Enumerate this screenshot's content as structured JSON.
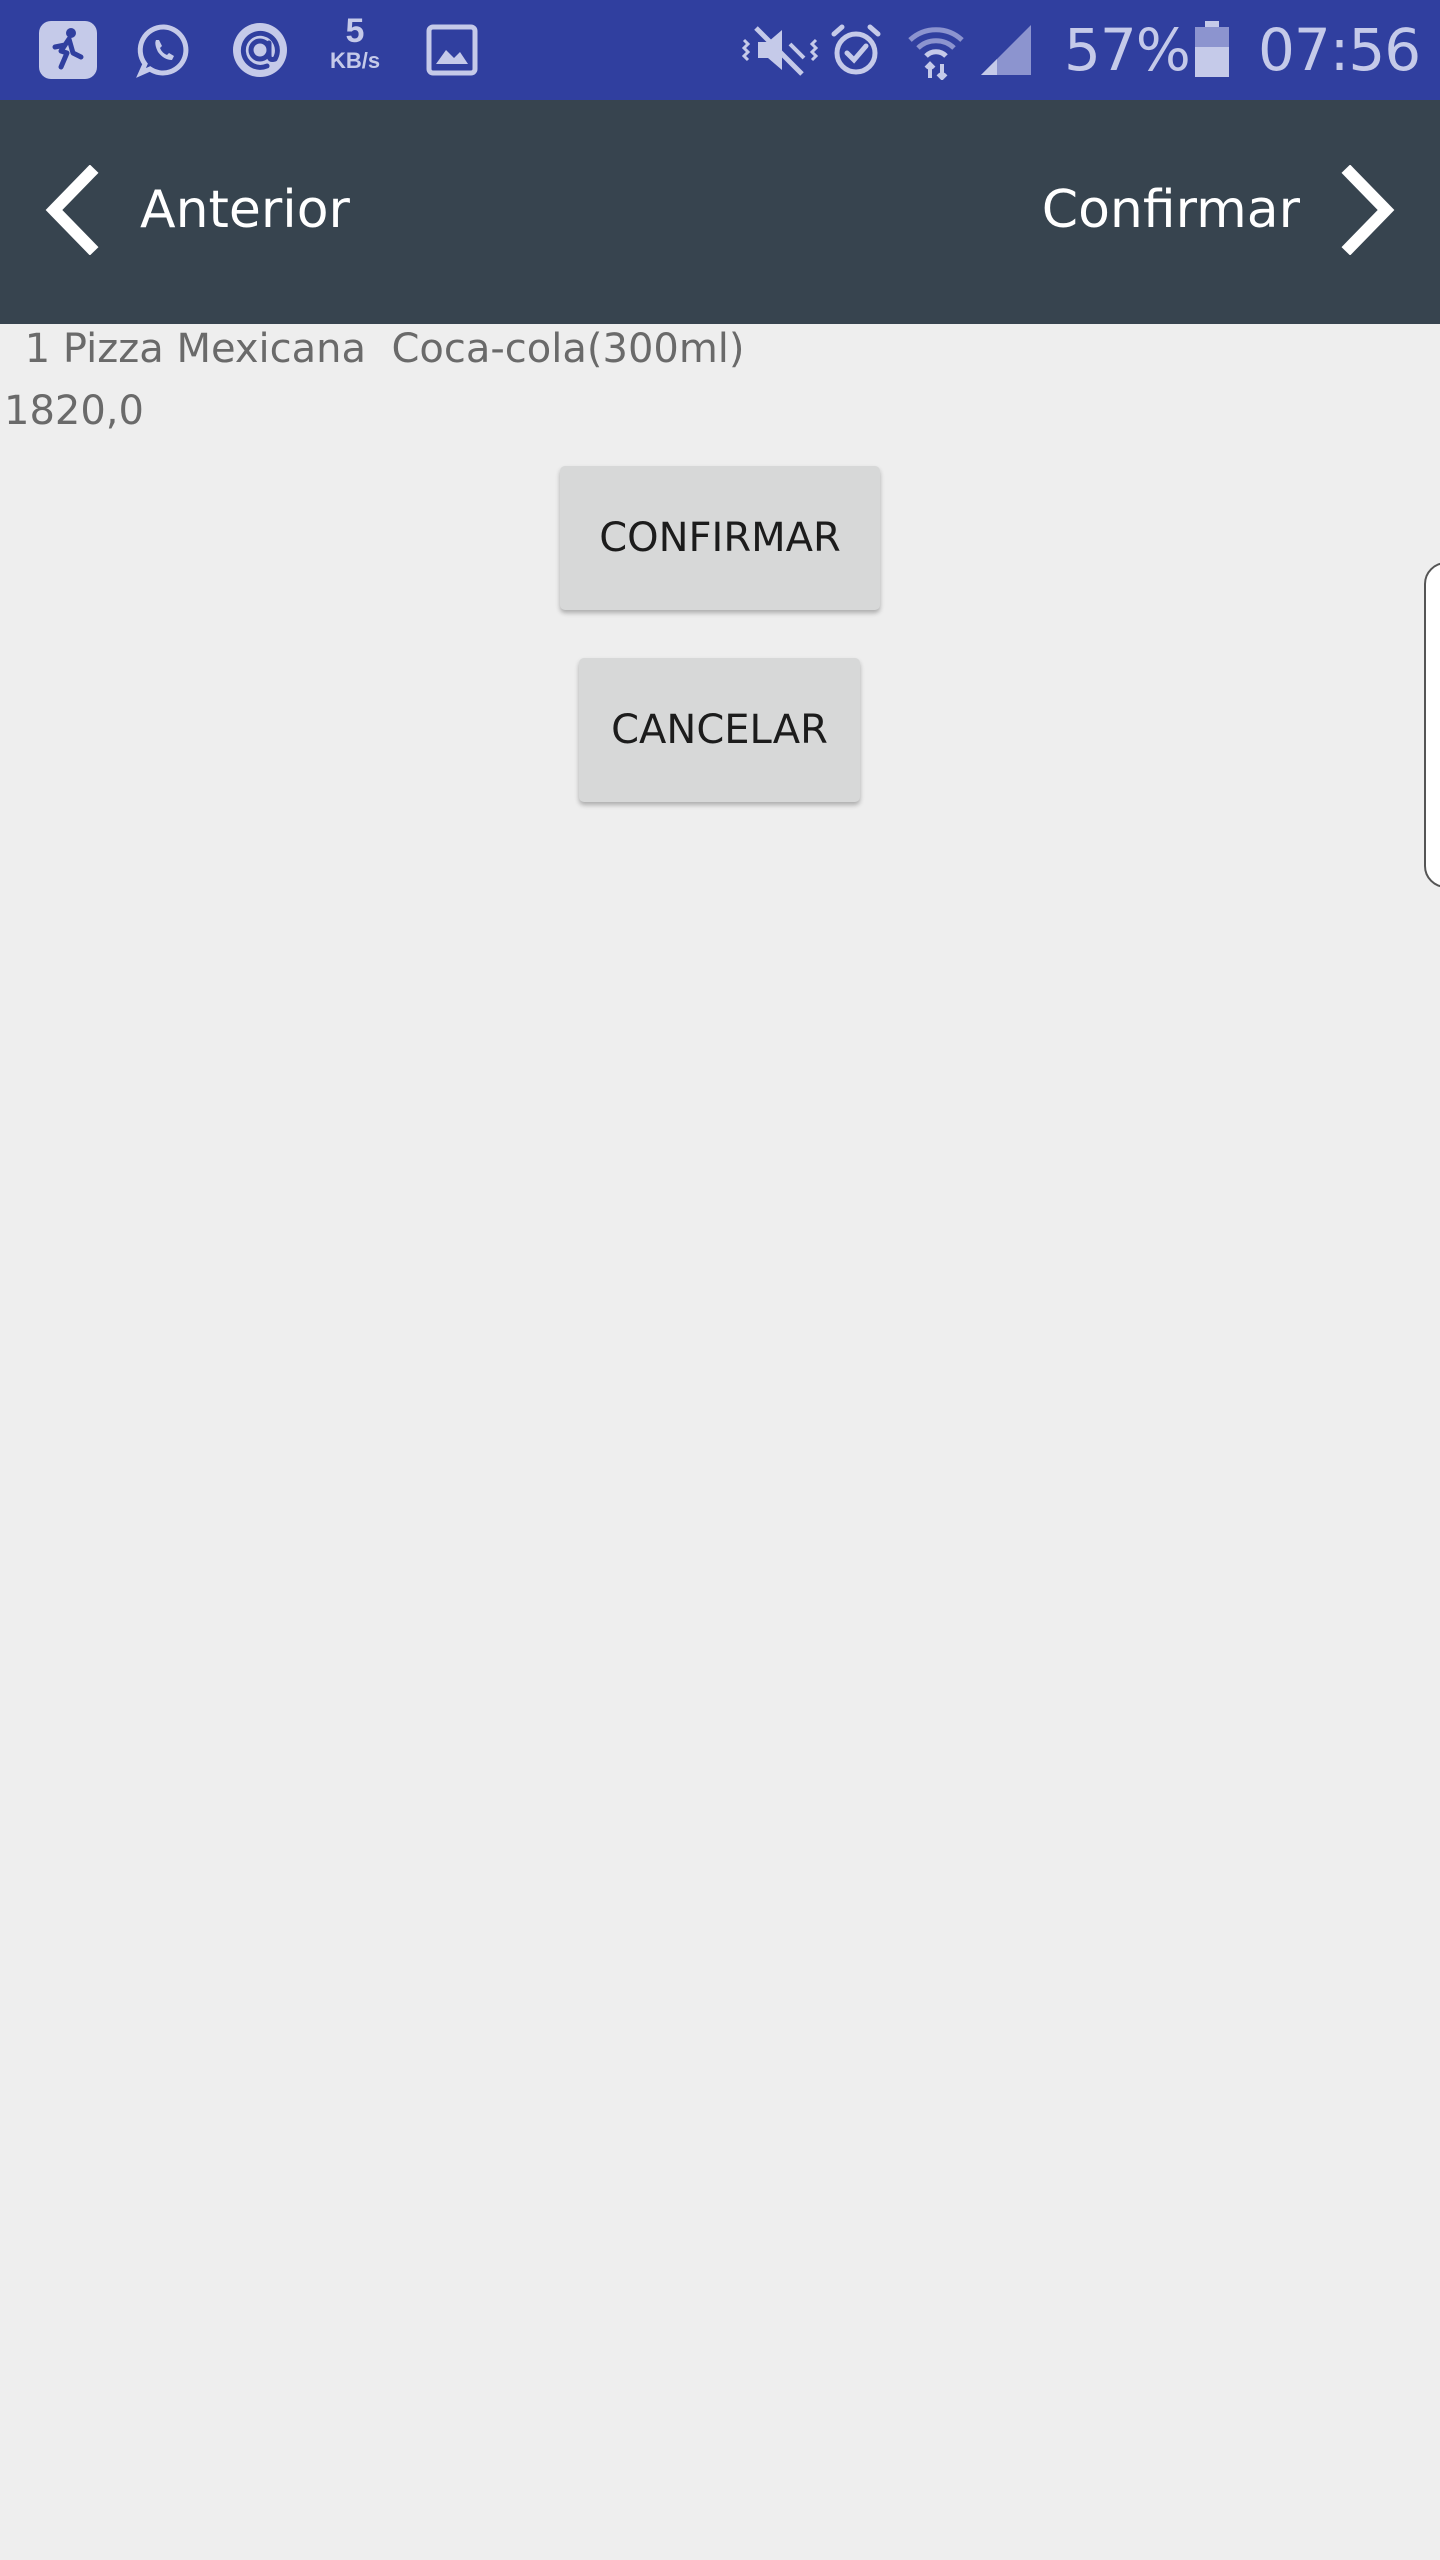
{
  "status_bar": {
    "icons": [
      "runner-icon",
      "whatsapp-icon",
      "at-sign-icon",
      "network-speed",
      "image-icon",
      "mute-icon",
      "alarm-icon",
      "wifi-icon",
      "signal-icon",
      "battery-icon"
    ],
    "speed_value": "5",
    "speed_unit": "KB/s",
    "battery_percent": "57%",
    "time": "07:56",
    "background_color": "#303f9f",
    "icon_color": "#c5cae9"
  },
  "nav": {
    "background_color": "#37444f",
    "prev_label": "Anterior",
    "next_label": "Confirmar"
  },
  "order": {
    "items_text": " 1 Pizza Mexicana  Coca-cola(300ml)",
    "total": "1820,0"
  },
  "actions": {
    "confirm_label": "CONFIRMAR",
    "cancel_label": "CANCELAR"
  }
}
